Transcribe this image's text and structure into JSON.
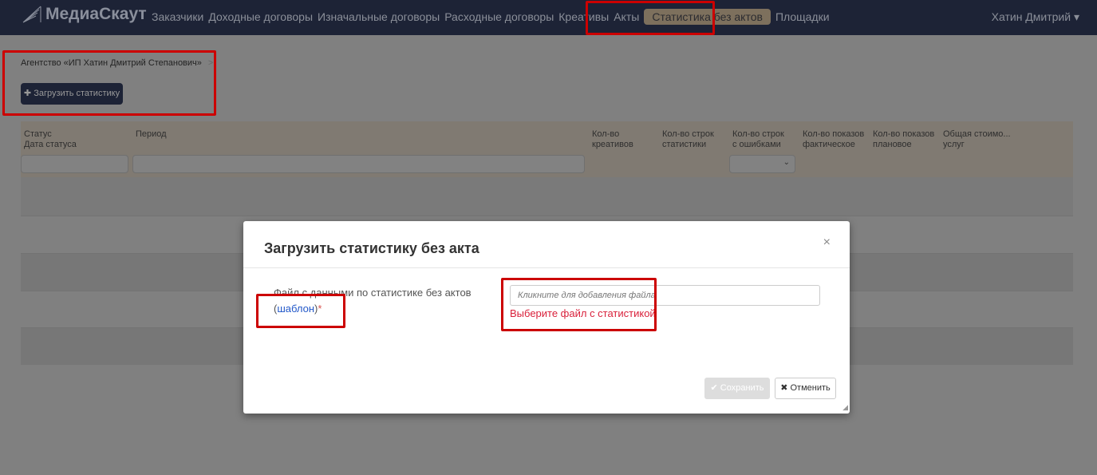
{
  "nav": {
    "logo": "МедиаСкаут",
    "items": [
      "Заказчики",
      "Доходные договоры",
      "Изначальные договоры",
      "Расходные договоры",
      "Креативы",
      "Акты",
      "Статистика без актов",
      "Площадки"
    ],
    "active": "Статистика без актов",
    "user": "Хатин Дмитрий ▾"
  },
  "breadcrumb": {
    "agency": "Агентство «ИП Хатин Дмитрий Степанович»",
    "sep": ">"
  },
  "upload_button": "✚ Загрузить статистику",
  "table": {
    "columns": [
      "Статус\nДата статуса",
      "Период",
      "Кол-во креативов",
      "Кол-во строк статистики",
      "Кол-во строк с ошибками",
      "Кол-во показов фактическое",
      "Кол-во показов плановое",
      "Общая стоимо... услуг"
    ]
  },
  "modal": {
    "title": "Загрузить статистику без акта",
    "close": "×",
    "field_label": "Файл с данными по статистике без актов",
    "template_open": "(",
    "template_link": "шаблон",
    "template_close": ")",
    "required": "*",
    "file_placeholder": "Кликните для добавления файла",
    "error": "Выберите файл с статистикой",
    "save": "✔ Сохранить",
    "cancel": "✖ Отменить"
  },
  "colors": {
    "navbar": "#1d2336",
    "accent_annotation": "#cc0000",
    "error": "#d9213b",
    "link": "#2258c9"
  }
}
